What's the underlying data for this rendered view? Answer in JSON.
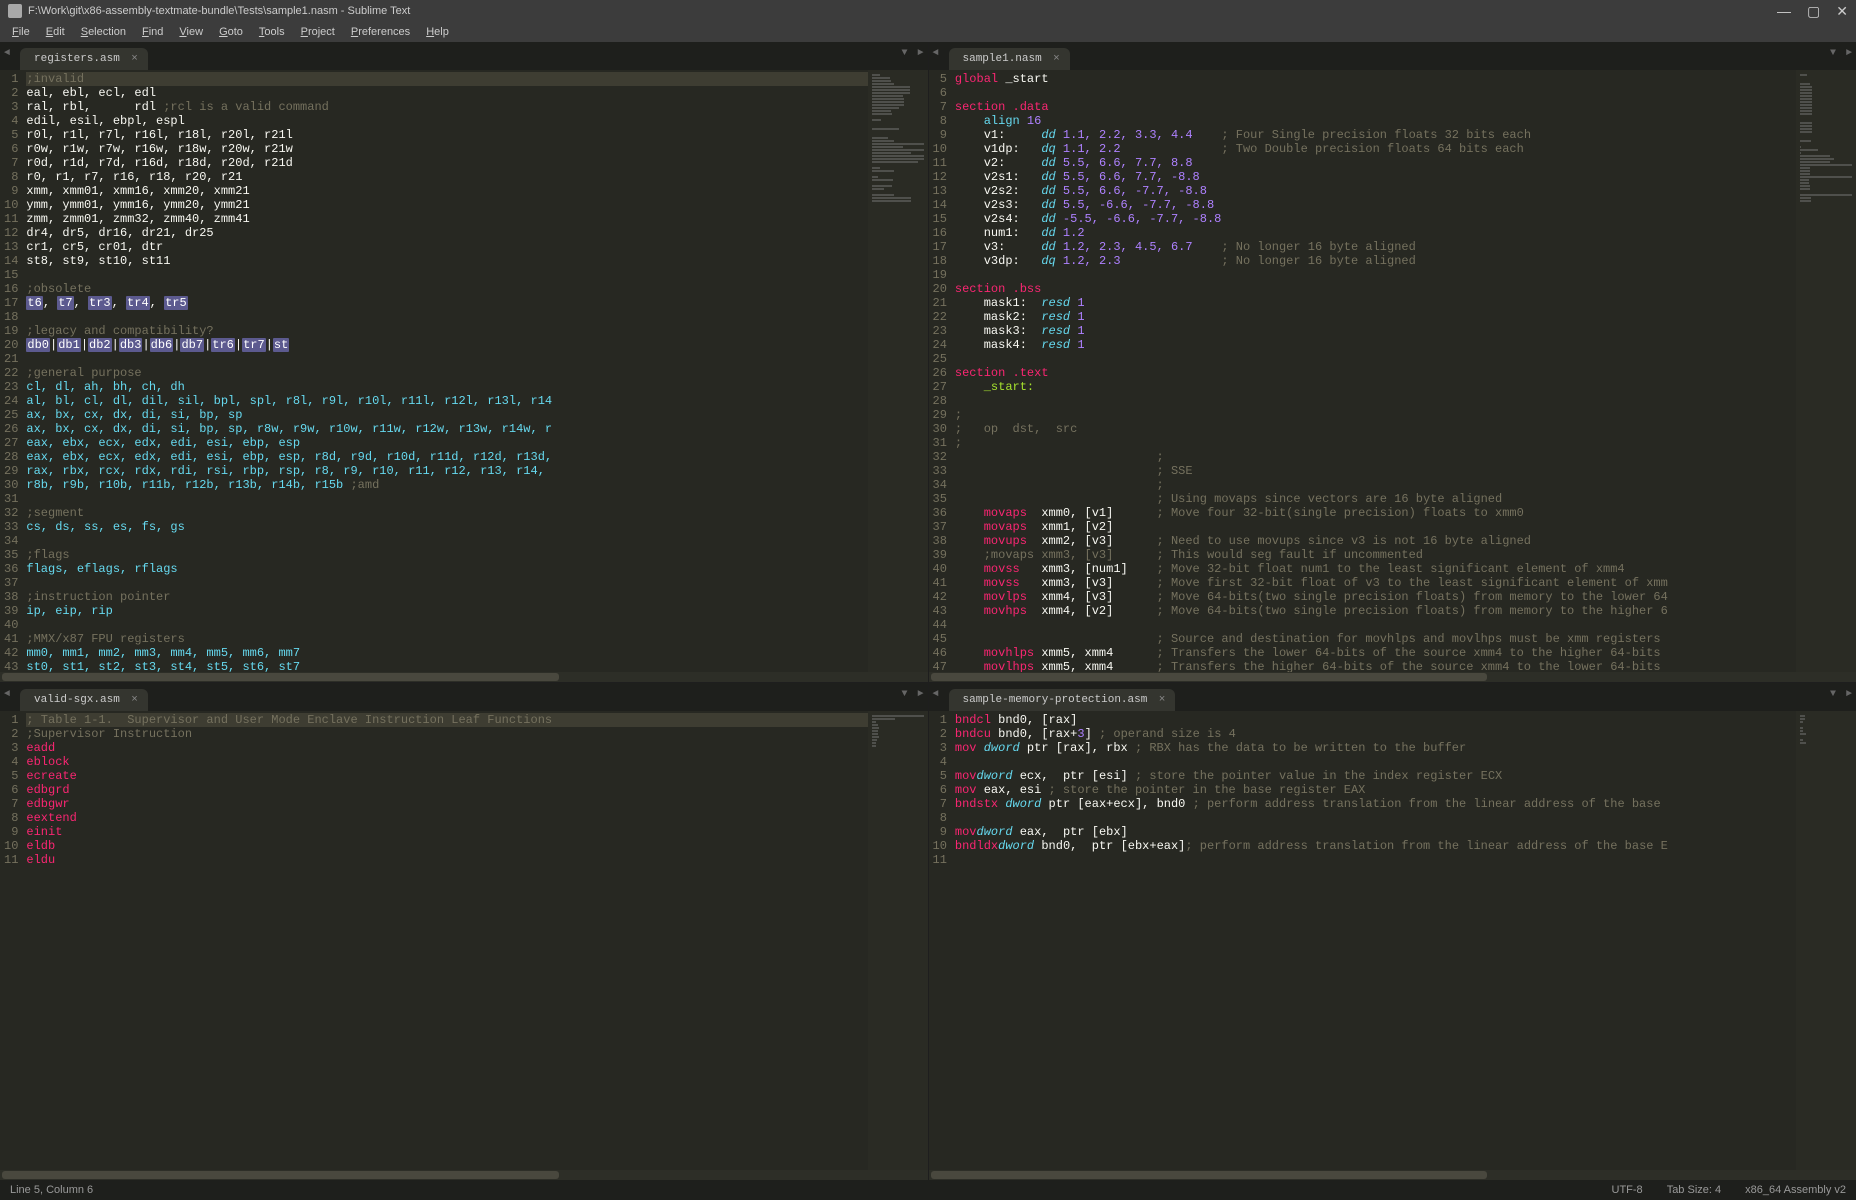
{
  "window": {
    "title": "F:\\Work\\git\\x86-assembly-textmate-bundle\\Tests\\sample1.nasm - Sublime Text",
    "controls": {
      "min": "—",
      "max": "▢",
      "close": "✕"
    }
  },
  "menu": [
    "File",
    "Edit",
    "Selection",
    "Find",
    "View",
    "Goto",
    "Tools",
    "Project",
    "Preferences",
    "Help"
  ],
  "status": {
    "pos": "Line 5, Column 6",
    "encoding": "UTF-8",
    "indent": "Tab Size: 4",
    "syntax": "x86_64 Assembly v2"
  },
  "panes": {
    "tl": {
      "tab": "registers.asm",
      "start": 1
    },
    "tr": {
      "tab": "sample1.nasm",
      "start": 5
    },
    "bl": {
      "tab": "valid-sgx.asm",
      "start": 1
    },
    "br": {
      "tab": "sample-memory-protection.asm",
      "start": 1
    }
  },
  "code_tl": [
    {
      "t": ";invalid",
      "cls": "c-comment",
      "hl": true
    },
    {
      "t": "eal, ebl, ecl, edl"
    },
    {
      "t": "ral, rbl,      rdl ",
      "suf": ";rcl is a valid command",
      "sufc": "c-comment"
    },
    {
      "t": "edil, esil, ebpl, espl"
    },
    {
      "t": "r0l, r1l, r7l, r16l, r18l, r20l, r21l"
    },
    {
      "t": "r0w, r1w, r7w, r16w, r18w, r20w, r21w"
    },
    {
      "t": "r0d, r1d, r7d, r16d, r18d, r20d, r21d"
    },
    {
      "t": "r0, r1, r7, r16, r18, r20, r21"
    },
    {
      "t": "xmm, xmm01, xmm16, xmm20, xmm21"
    },
    {
      "t": "ymm, ymm01, ymm16, ymm20, ymm21"
    },
    {
      "t": "zmm, zmm01, zmm32, zmm40, zmm41"
    },
    {
      "t": "dr4, dr5, dr16, dr21, dr25"
    },
    {
      "t": "cr1, cr5, cr01, dtr"
    },
    {
      "t": "st8, st9, st10, st11"
    },
    {
      "t": ""
    },
    {
      "t": ";obsolete",
      "cls": "c-comment"
    },
    {
      "sel": [
        "t6",
        "t7",
        "tr3",
        "tr4",
        "tr5"
      ]
    },
    {
      "t": ""
    },
    {
      "t": ";legacy and compatibility?",
      "cls": "c-comment"
    },
    {
      "sel2": [
        "db0",
        "db1",
        "db2",
        "db3",
        "db6",
        "db7",
        "tr6",
        "tr7",
        "st"
      ]
    },
    {
      "t": ""
    },
    {
      "t": ";general purpose",
      "cls": "c-comment"
    },
    {
      "t": "cl, dl, ah, bh, ch, dh",
      "cls": "c-inst"
    },
    {
      "t": "al, bl, cl, dl, dil, sil, bpl, spl, r8l, r9l, r10l, r11l, r12l, r13l, r14",
      "cls": "c-inst"
    },
    {
      "t": "ax, bx, cx, dx, di, si, bp, sp",
      "cls": "c-inst"
    },
    {
      "t": "ax, bx, cx, dx, di, si, bp, sp, r8w, r9w, r10w, r11w, r12w, r13w, r14w, r",
      "cls": "c-inst"
    },
    {
      "t": "eax, ebx, ecx, edx, edi, esi, ebp, esp",
      "cls": "c-inst"
    },
    {
      "t": "eax, ebx, ecx, edx, edi, esi, ebp, esp, r8d, r9d, r10d, r11d, r12d, r13d,",
      "cls": "c-inst"
    },
    {
      "t": "rax, rbx, rcx, rdx, rdi, rsi, rbp, rsp, r8, r9, r10, r11, r12, r13, r14,",
      "cls": "c-inst"
    },
    {
      "t": "r8b, r9b, r10b, r11b, r12b, r13b, r14b, r15b ",
      "cls": "c-inst",
      "suf": ";amd",
      "sufc": "c-comment"
    },
    {
      "t": ""
    },
    {
      "t": ";segment",
      "cls": "c-comment"
    },
    {
      "t": "cs, ds, ss, es, fs, gs",
      "cls": "c-inst"
    },
    {
      "t": ""
    },
    {
      "t": ";flags",
      "cls": "c-comment"
    },
    {
      "t": "flags, eflags, rflags",
      "cls": "c-inst"
    },
    {
      "t": ""
    },
    {
      "t": ";instruction pointer",
      "cls": "c-comment"
    },
    {
      "t": "ip, eip, rip",
      "cls": "c-inst"
    },
    {
      "t": ""
    },
    {
      "t": ";MMX/x87 FPU registers",
      "cls": "c-comment"
    },
    {
      "t": "mm0, mm1, mm2, mm3, mm4, mm5, mm6, mm7",
      "cls": "c-inst"
    },
    {
      "t": "st0, st1, st2, st3, st4, st5, st6, st7",
      "cls": "c-inst"
    }
  ],
  "code_tr": [
    {
      "pre": "global",
      "prec": "c-kw",
      "t": " _start"
    },
    {
      "t": ""
    },
    {
      "pre": "section",
      "prec": "c-kw",
      "mid": " .data",
      "midc": "c-kw"
    },
    {
      "t": "    align ",
      "tc": "c-inst",
      "suf": "16",
      "sufc": "c-num"
    },
    {
      "lbl": "    v1:     ",
      "dir": "dd",
      "nums": " 1.1, 2.2, 3.3, 4.4",
      "cmt": "    ; Four Single precision floats 32 bits each"
    },
    {
      "lbl": "    v1dp:   ",
      "dir": "dq",
      "nums": " 1.1, 2.2",
      "cmt": "              ; Two Double precision floats 64 bits each"
    },
    {
      "lbl": "    v2:     ",
      "dir": "dd",
      "nums": " 5.5, 6.6, 7.7, 8.8"
    },
    {
      "lbl": "    v2s1:   ",
      "dir": "dd",
      "nums": " 5.5, 6.6, 7.7, -8.8"
    },
    {
      "lbl": "    v2s2:   ",
      "dir": "dd",
      "nums": " 5.5, 6.6, -7.7, -8.8"
    },
    {
      "lbl": "    v2s3:   ",
      "dir": "dd",
      "nums": " 5.5, -6.6, -7.7, -8.8"
    },
    {
      "lbl": "    v2s4:   ",
      "dir": "dd",
      "nums": " -5.5, -6.6, -7.7, -8.8"
    },
    {
      "lbl": "    num1:   ",
      "dir": "dd",
      "nums": " 1.2"
    },
    {
      "lbl": "    v3:     ",
      "dir": "dd",
      "nums": " 1.2, 2.3, 4.5, 6.7",
      "cmt": "    ; No longer 16 byte aligned"
    },
    {
      "lbl": "    v3dp:   ",
      "dir": "dq",
      "nums": " 1.2, 2.3",
      "cmt": "              ; No longer 16 byte aligned"
    },
    {
      "t": ""
    },
    {
      "pre": "section",
      "prec": "c-kw",
      "mid": " .bss",
      "midc": "c-kw"
    },
    {
      "lbl": "    mask1:  ",
      "dir": "resd",
      "nums": " 1"
    },
    {
      "lbl": "    mask2:  ",
      "dir": "resd",
      "nums": " 1"
    },
    {
      "lbl": "    mask3:  ",
      "dir": "resd",
      "nums": " 1"
    },
    {
      "lbl": "    mask4:  ",
      "dir": "resd",
      "nums": " 1"
    },
    {
      "t": ""
    },
    {
      "pre": "section",
      "prec": "c-kw",
      "mid": " .text",
      "midc": "c-kw"
    },
    {
      "t": "    _start:",
      "cls": "c-label"
    },
    {
      "t": ""
    },
    {
      "t": ";",
      "cls": "c-comment"
    },
    {
      "t": ";   op  dst,  src",
      "cls": "c-comment"
    },
    {
      "t": ";",
      "cls": "c-comment"
    },
    {
      "t": "                            ;",
      "cls": "c-comment"
    },
    {
      "t": "                            ; SSE",
      "cls": "c-comment"
    },
    {
      "t": "                            ;",
      "cls": "c-comment"
    },
    {
      "t": "                            ; Using movaps since vectors are 16 byte aligned",
      "cls": "c-comment"
    },
    {
      "inst": "    movaps",
      "ops": "  xmm0, [v1]",
      "cmt": "      ; Move four 32-bit(single precision) floats to xmm0"
    },
    {
      "inst": "    movaps",
      "ops": "  xmm1, [v2]"
    },
    {
      "inst": "    movups",
      "ops": "  xmm2, [v3]",
      "cmt": "      ; Need to use movups since v3 is not 16 byte aligned"
    },
    {
      "t": "    ;movaps xmm3, [v3]      ; This would seg fault if uncommented",
      "cls": "c-comment"
    },
    {
      "inst": "    movss",
      "ops": "   xmm3, [num1]",
      "cmt": "    ; Move 32-bit float num1 to the least significant element of xmm4"
    },
    {
      "inst": "    movss",
      "ops": "   xmm3, [v3]",
      "cmt": "      ; Move first 32-bit float of v3 to the least significant element of xmm"
    },
    {
      "inst": "    movlps",
      "ops": "  xmm4, [v3]",
      "cmt": "      ; Move 64-bits(two single precision floats) from memory to the lower 64"
    },
    {
      "inst": "    movhps",
      "ops": "  xmm4, [v2]",
      "cmt": "      ; Move 64-bits(two single precision floats) from memory to the higher 6"
    },
    {
      "t": ""
    },
    {
      "t": "                            ; Source and destination for movhlps and movlhps must be xmm registers",
      "cls": "c-comment"
    },
    {
      "inst": "    movhlps",
      "ops": " xmm5, xmm4",
      "cmt": "      ; Transfers the lower 64-bits of the source xmm4 to the higher 64-bits"
    },
    {
      "inst": "    movlhps",
      "ops": " xmm5, xmm4",
      "cmt": "      ; Transfers the higher 64-bits of the source xmm4 to the lower 64-bits"
    }
  ],
  "code_bl": [
    {
      "t": "; Table 1-1.  Supervisor and User Mode Enclave Instruction Leaf Functions",
      "cls": "c-comment",
      "hl": true
    },
    {
      "t": ";Supervisor Instruction",
      "cls": "c-comment"
    },
    {
      "t": "eadd",
      "cls": "c-kw"
    },
    {
      "t": "eblock",
      "cls": "c-kw"
    },
    {
      "t": "ecreate",
      "cls": "c-kw"
    },
    {
      "t": "edbgrd",
      "cls": "c-kw"
    },
    {
      "t": "edbgwr",
      "cls": "c-kw"
    },
    {
      "t": "eextend",
      "cls": "c-kw"
    },
    {
      "t": "einit",
      "cls": "c-kw"
    },
    {
      "t": "eldb",
      "cls": "c-kw"
    },
    {
      "t": "eldu",
      "cls": "c-kw"
    }
  ],
  "code_br": [
    {
      "inst": "bndcl",
      "ops": " bnd0",
      "mem": ", [rax]"
    },
    {
      "inst": "bndcu",
      "ops": " bnd0",
      "mem": ", [rax+",
      "num": "3",
      "memend": "] ",
      "cmt": "; operand size is 4"
    },
    {
      "inst": "mov",
      "type": " dword",
      "ops": " ptr [rax], rbx ",
      "cmt": "; RBX has the data to be written to the buffer"
    },
    {
      "t": ""
    },
    {
      "inst": "mov",
      "ops": " ecx, ",
      "type": "dword",
      "ops2": " ptr [esi] ",
      "cmt": "; store the pointer value in the index register ECX"
    },
    {
      "inst": "mov",
      "ops": " eax, esi ",
      "cmt": "; store the pointer in the base register EAX"
    },
    {
      "inst": "bndstx",
      "type": " dword",
      "ops": " ptr [eax+ecx], bnd0 ",
      "cmt": "; perform address translation from the linear address of the base"
    },
    {
      "t": ""
    },
    {
      "inst": "mov",
      "ops": " eax, ",
      "type": "dword",
      "ops2": " ptr [ebx]"
    },
    {
      "inst": "bndldx",
      "ops": " bnd0, ",
      "type": "dword",
      "ops2": " ptr [ebx+eax]",
      "cmt": "; perform address translation from the linear address of the base E"
    },
    {
      "t": ""
    }
  ]
}
